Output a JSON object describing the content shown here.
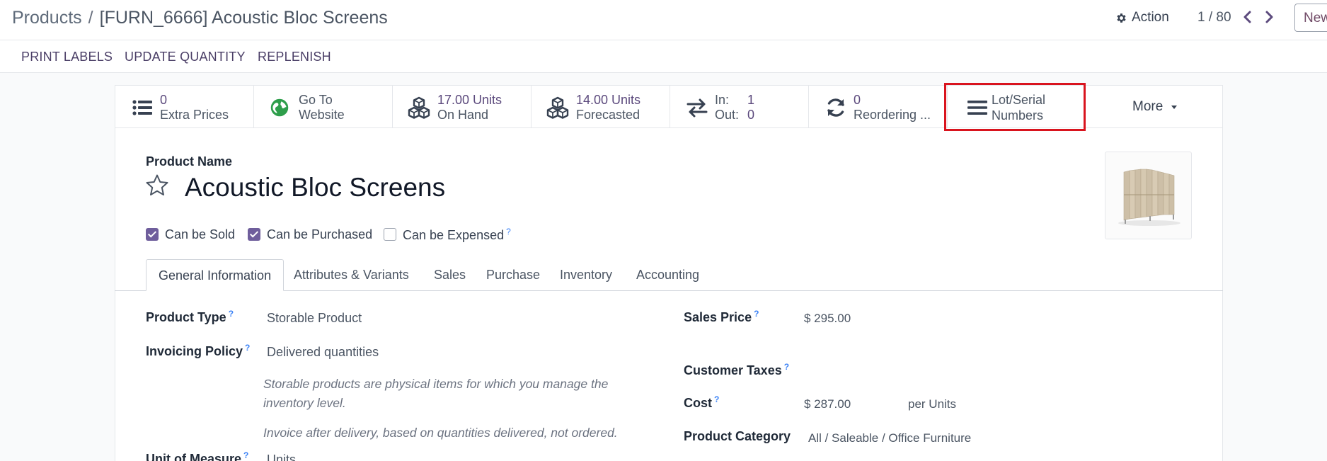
{
  "header": {
    "breadcrumb_root": "Products",
    "breadcrumb_separator": "/",
    "breadcrumb_current": "[FURN_6666] Acoustic Bloc Screens",
    "action_label": "Action",
    "pager": "1 / 80",
    "new_label": "New"
  },
  "toolbar": {
    "print_labels": "PRINT LABELS",
    "update_quantity": "UPDATE QUANTITY",
    "replenish": "REPLENISH"
  },
  "stats": {
    "extra_prices": {
      "value": "0",
      "label": "Extra Prices"
    },
    "website": {
      "line1": "Go To",
      "line2": "Website"
    },
    "on_hand": {
      "value": "17.00 Units",
      "label": "On Hand"
    },
    "forecasted": {
      "value": "14.00 Units",
      "label": "Forecasted"
    },
    "in_out": {
      "in_label": "In:",
      "in_value": "1",
      "out_label": "Out:",
      "out_value": "0"
    },
    "reordering": {
      "value": "0",
      "label": "Reordering ..."
    },
    "lots": {
      "line1": "Lot/Serial",
      "line2": "Numbers"
    },
    "more_label": "More"
  },
  "form": {
    "name_label": "Product Name",
    "product_name": "Acoustic Bloc Screens",
    "can_be_sold": "Can be Sold",
    "can_be_purchased": "Can be Purchased",
    "can_be_expensed": "Can be Expensed",
    "help_mark": "?"
  },
  "tabs": [
    "General Information",
    "Attributes & Variants",
    "Sales",
    "Purchase",
    "Inventory",
    "Accounting"
  ],
  "general": {
    "product_type_label": "Product Type",
    "product_type_value": "Storable Product",
    "invoicing_policy_label": "Invoicing Policy",
    "invoicing_policy_value": "Delivered quantities",
    "storable_note": "Storable products are physical items for which you manage the inventory level.",
    "invoice_note": "Invoice after delivery, based on quantities delivered, not ordered.",
    "uom_label": "Unit of Measure",
    "uom_value": "Units",
    "sales_price_label": "Sales Price",
    "sales_price_value": "$ 295.00",
    "customer_taxes_label": "Customer Taxes",
    "cost_label": "Cost",
    "cost_value": "$ 287.00",
    "cost_unit": "per Units",
    "category_label": "Product Category",
    "category_value": "All / Saleable / Office Furniture"
  },
  "colors": {
    "accent": "#6f5e9c",
    "stat_value": "#5c4a7d",
    "highlight": "#d9141e",
    "website_icon": "#2e9e4b"
  }
}
